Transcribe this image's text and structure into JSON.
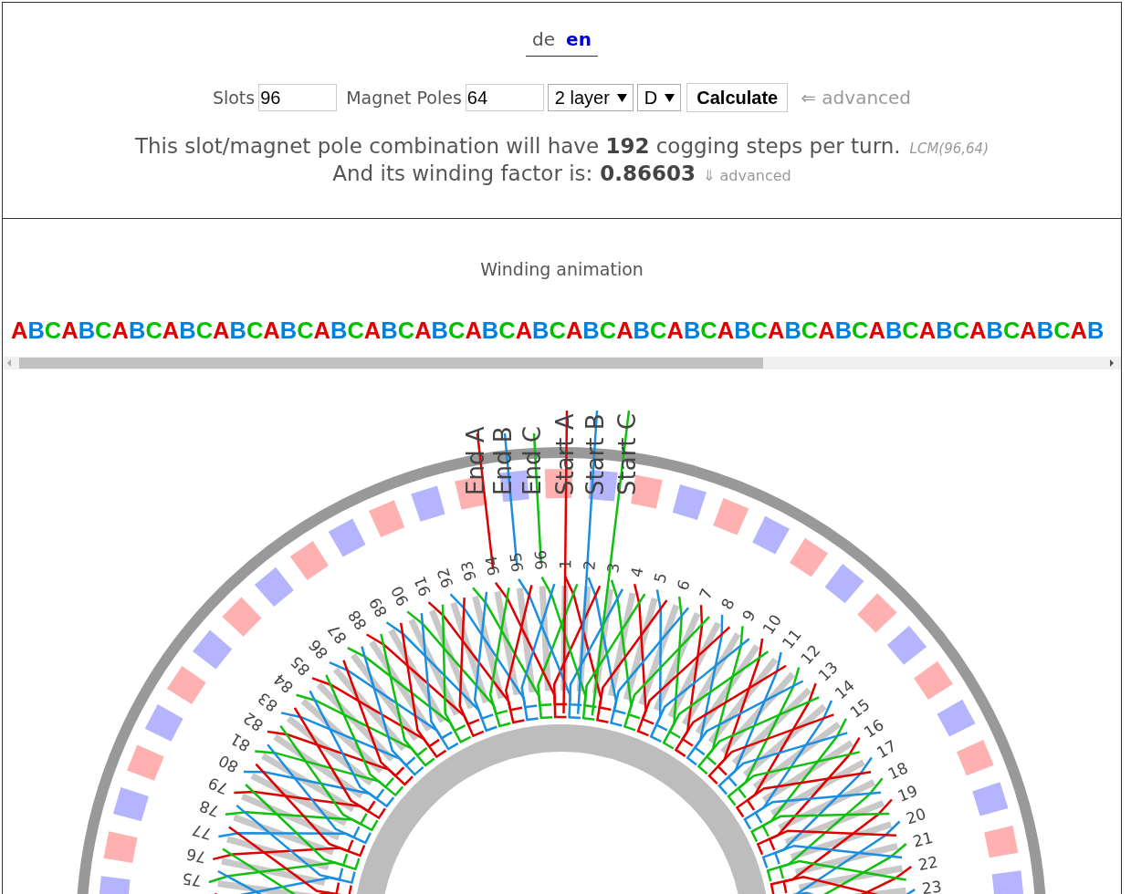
{
  "language_switcher": {
    "items": [
      {
        "label": "de",
        "selected": false
      },
      {
        "label": "en",
        "selected": true
      }
    ]
  },
  "controls": {
    "slots_label": "Slots",
    "slots": "96",
    "poles_label": "Magnet Poles",
    "poles": "64",
    "layer_select": "2 layer",
    "connection_select": "D",
    "calculate_button": "Calculate",
    "advanced_link": "⇐ advanced"
  },
  "summary": {
    "cogging_text": "This slot/magnet pole combination will have **192** cogging steps per turn.",
    "lcm_note": "LCM(96,64)",
    "winding_factor_label": "And its winding factor is:",
    "winding_factor": "0.86603",
    "advanced_link": "⇓ advanced"
  },
  "animation": {
    "title": "Winding animation",
    "phase_sequence": [
      {
        "letter": "A",
        "color": "#e00000"
      },
      {
        "letter": "B",
        "color": "#0080e0"
      },
      {
        "letter": "C",
        "color": "#00c000"
      },
      {
        "letter": "A",
        "color": "#e00000"
      },
      {
        "letter": "B",
        "color": "#0080e0"
      },
      {
        "letter": "C",
        "color": "#00c000"
      },
      {
        "letter": "A",
        "color": "#e00000"
      },
      {
        "letter": "B",
        "color": "#0080e0"
      },
      {
        "letter": "C",
        "color": "#00c000"
      },
      {
        "letter": "A",
        "color": "#e00000"
      },
      {
        "letter": "B",
        "color": "#0080e0"
      },
      {
        "letter": "C",
        "color": "#00c000"
      },
      {
        "letter": "A",
        "color": "#e00000"
      },
      {
        "letter": "B",
        "color": "#0080e0"
      },
      {
        "letter": "C",
        "color": "#00c000"
      },
      {
        "letter": "A",
        "color": "#e00000"
      },
      {
        "letter": "B",
        "color": "#0080e0"
      },
      {
        "letter": "C",
        "color": "#00c000"
      },
      {
        "letter": "A",
        "color": "#e00000"
      },
      {
        "letter": "B",
        "color": "#0080e0"
      },
      {
        "letter": "C",
        "color": "#00c000"
      },
      {
        "letter": "A",
        "color": "#e00000"
      },
      {
        "letter": "B",
        "color": "#0080e0"
      },
      {
        "letter": "C",
        "color": "#00c000"
      },
      {
        "letter": "A",
        "color": "#e00000"
      },
      {
        "letter": "B",
        "color": "#0080e0"
      },
      {
        "letter": "C",
        "color": "#00c000"
      },
      {
        "letter": "A",
        "color": "#e00000"
      },
      {
        "letter": "B",
        "color": "#0080e0"
      },
      {
        "letter": "C",
        "color": "#00c000"
      },
      {
        "letter": "A",
        "color": "#e00000"
      },
      {
        "letter": "B",
        "color": "#0080e0"
      },
      {
        "letter": "C",
        "color": "#00c000"
      },
      {
        "letter": "A",
        "color": "#e00000"
      },
      {
        "letter": "B",
        "color": "#0080e0"
      },
      {
        "letter": "C",
        "color": "#00c000"
      },
      {
        "letter": "A",
        "color": "#e00000"
      },
      {
        "letter": "B",
        "color": "#0080e0"
      },
      {
        "letter": "C",
        "color": "#00c000"
      },
      {
        "letter": "A",
        "color": "#e00000"
      },
      {
        "letter": "B",
        "color": "#0080e0"
      },
      {
        "letter": "C",
        "color": "#00c000"
      },
      {
        "letter": "A",
        "color": "#e00000"
      },
      {
        "letter": "B",
        "color": "#0080e0"
      },
      {
        "letter": "C",
        "color": "#00c000"
      },
      {
        "letter": "A",
        "color": "#e00000"
      },
      {
        "letter": "B",
        "color": "#0080e0"
      },
      {
        "letter": "C",
        "color": "#00c000"
      },
      {
        "letter": "A",
        "color": "#e00000"
      },
      {
        "letter": "B",
        "color": "#0080e0"
      },
      {
        "letter": "C",
        "color": "#00c000"
      },
      {
        "letter": "A",
        "color": "#e00000"
      },
      {
        "letter": "B",
        "color": "#0080e0"
      },
      {
        "letter": "C",
        "color": "#00c000"
      },
      {
        "letter": "A",
        "color": "#e00000"
      },
      {
        "letter": "B",
        "color": "#0080e0"
      },
      {
        "letter": "C",
        "color": "#00c000"
      },
      {
        "letter": "A",
        "color": "#e00000"
      },
      {
        "letter": "B",
        "color": "#0080e0"
      },
      {
        "letter": "C",
        "color": "#00c000"
      },
      {
        "letter": "A",
        "color": "#e00000"
      },
      {
        "letter": "B",
        "color": "#0080e0"
      },
      {
        "letter": "C",
        "color": "#00c000"
      },
      {
        "letter": "A",
        "color": "#e00000"
      },
      {
        "letter": "B",
        "color": "#0080e0"
      }
    ]
  },
  "diagram": {
    "lead_labels": [
      "End A",
      "End B",
      "End C",
      "Start A",
      "Start B",
      "Start C"
    ],
    "slot_labels": [
      "75",
      "76",
      "77",
      "78",
      "79",
      "80",
      "81",
      "82",
      "83",
      "84",
      "85",
      "86",
      "87",
      "88",
      "89",
      "90",
      "91",
      "92",
      "93",
      "94",
      "95",
      "96",
      "1",
      "2",
      "3",
      "4",
      "5",
      "6",
      "7",
      "8",
      "9",
      "10",
      "11",
      "12",
      "13",
      "14",
      "15",
      "16",
      "17",
      "18",
      "19",
      "20",
      "21",
      "22",
      "23"
    ]
  }
}
